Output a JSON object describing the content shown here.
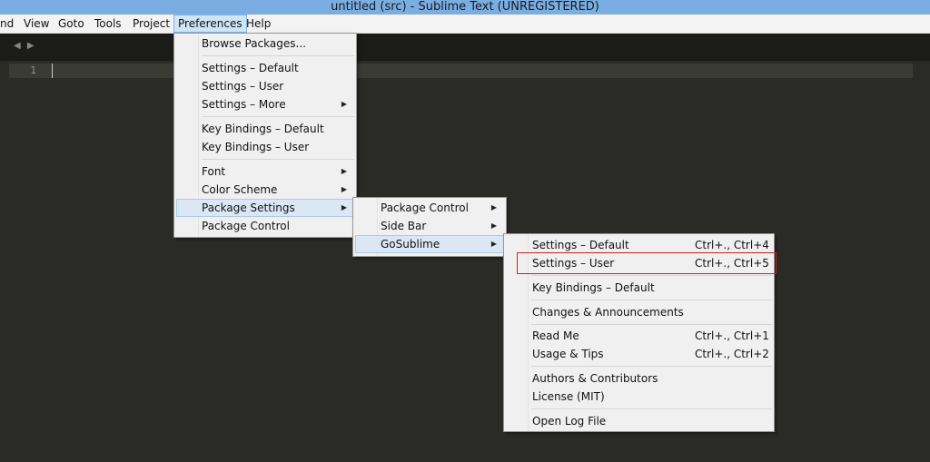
{
  "window": {
    "title": "untitled (src) - Sublime Text (UNREGISTERED)"
  },
  "menubar": {
    "items": [
      "nd",
      "View",
      "Goto",
      "Tools",
      "Project",
      "Preferences",
      "Help"
    ],
    "active": "Preferences"
  },
  "editor": {
    "line_number": "1"
  },
  "preferences_menu": {
    "browse_packages": "Browse Packages...",
    "settings_default": "Settings – Default",
    "settings_user": "Settings – User",
    "settings_more": "Settings – More",
    "key_bindings_default": "Key Bindings – Default",
    "key_bindings_user": "Key Bindings – User",
    "font": "Font",
    "color_scheme": "Color Scheme",
    "package_settings": "Package Settings",
    "package_control": "Package Control"
  },
  "package_settings_menu": {
    "package_control": "Package Control",
    "side_bar": "Side Bar",
    "gosublime": "GoSublime"
  },
  "gosublime_menu": {
    "items": [
      {
        "label": "Settings – Default",
        "shortcut": "Ctrl+., Ctrl+4"
      },
      {
        "label": "Settings – User",
        "shortcut": "Ctrl+., Ctrl+5"
      },
      {
        "label": "Key Bindings – Default",
        "shortcut": ""
      },
      {
        "label": "Changes & Announcements",
        "shortcut": ""
      },
      {
        "label": "Read Me",
        "shortcut": "Ctrl+., Ctrl+1"
      },
      {
        "label": "Usage & Tips",
        "shortcut": "Ctrl+., Ctrl+2"
      },
      {
        "label": "Authors & Contributors",
        "shortcut": ""
      },
      {
        "label": "License (MIT)",
        "shortcut": ""
      },
      {
        "label": "Open Log File",
        "shortcut": ""
      }
    ]
  },
  "icons": {
    "submenu_arrow": "▶",
    "tab_nav": "◀ ▶"
  },
  "colors": {
    "titlebar": "#7aaee3",
    "editor_bg": "#2a2a27",
    "menu_bg": "#f0f0f0",
    "highlight_bg": "#dbe7f5",
    "annotation_box": "#d02020"
  }
}
